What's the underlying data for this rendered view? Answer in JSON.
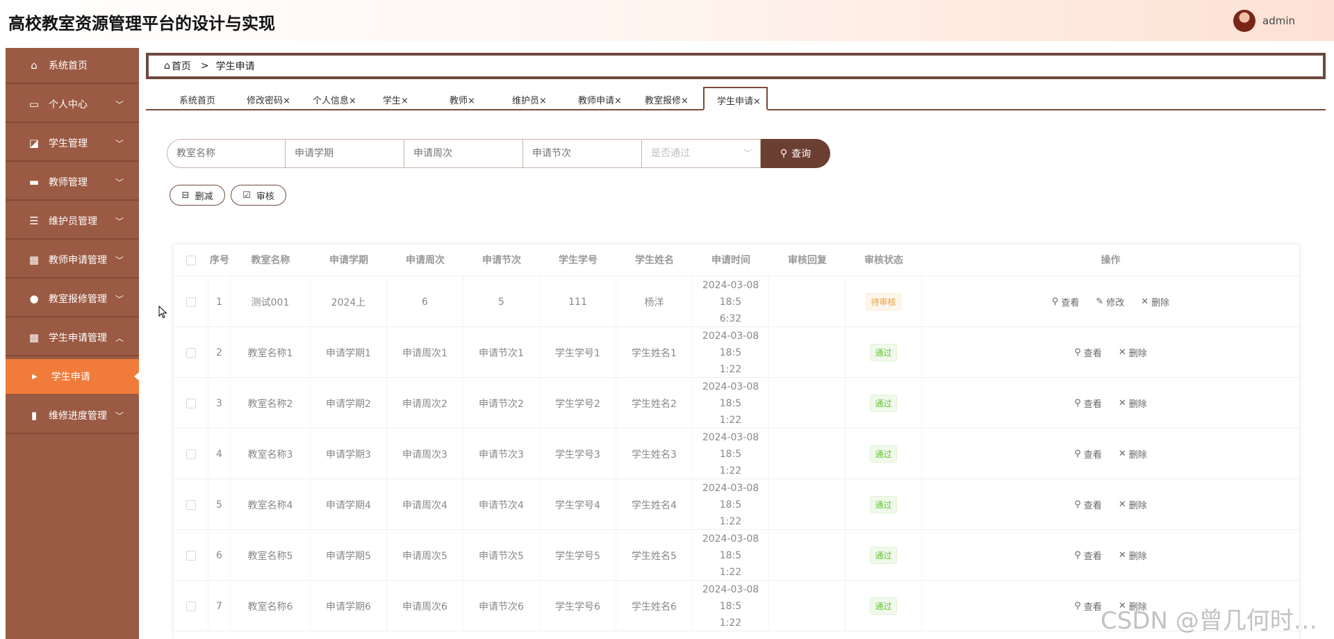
{
  "app": {
    "title": "高校教室资源管理平台的设计与实现",
    "username": "admin"
  },
  "sidebar": {
    "items": [
      {
        "label": "系统首页",
        "icon": "home-icon",
        "has_arrow": false
      },
      {
        "label": "个人中心",
        "icon": "id-card-icon",
        "has_arrow": true
      },
      {
        "label": "学生管理",
        "icon": "chart-icon",
        "has_arrow": true
      },
      {
        "label": "教师管理",
        "icon": "printer-icon",
        "has_arrow": true
      },
      {
        "label": "维护员管理",
        "icon": "list-icon",
        "has_arrow": true
      },
      {
        "label": "教师申请管理",
        "icon": "grid-icon",
        "has_arrow": true
      },
      {
        "label": "教室报修管理",
        "icon": "user-icon",
        "has_arrow": true
      },
      {
        "label": "学生申请管理",
        "icon": "grid-icon",
        "has_arrow": true,
        "expanded": true
      },
      {
        "label": "维修进度管理",
        "icon": "bar-chart-icon",
        "has_arrow": true
      }
    ],
    "sub_item": {
      "label": "学生申请"
    }
  },
  "breadcrumb": {
    "home": "首页",
    "separator": ">",
    "current": "学生申请"
  },
  "tabs": [
    {
      "label": "系统首页",
      "closable": false
    },
    {
      "label": "修改密码",
      "closable": true
    },
    {
      "label": "个人信息",
      "closable": true
    },
    {
      "label": "学生",
      "closable": true
    },
    {
      "label": "教师",
      "closable": true
    },
    {
      "label": "维护员",
      "closable": true
    },
    {
      "label": "教师申请",
      "closable": true
    },
    {
      "label": "教室报修",
      "closable": true
    },
    {
      "label": "学生申请",
      "closable": true,
      "active": true
    }
  ],
  "search": {
    "fields": [
      {
        "placeholder": "教室名称"
      },
      {
        "placeholder": "申请学期"
      },
      {
        "placeholder": "申请周次"
      },
      {
        "placeholder": "申请节次"
      }
    ],
    "select_placeholder": "是否通过",
    "button_label": "查询"
  },
  "actions": {
    "delete_label": "删减",
    "review_label": "审核"
  },
  "table": {
    "headers": [
      "序号",
      "教室名称",
      "申请学期",
      "申请周次",
      "申请节次",
      "学生学号",
      "学生姓名",
      "申请时间",
      "审核回复",
      "审核状态",
      "操作"
    ],
    "ops": {
      "view": "查看",
      "edit": "修改",
      "delete": "删除"
    },
    "rows": [
      {
        "no": "1",
        "room": "测试001",
        "term": "2024上",
        "week": "6",
        "period": "5",
        "sid": "111",
        "sname": "杨洋",
        "time1": "2024-03-08 18:5",
        "time2": "6:32",
        "reply": "",
        "status": "待审核",
        "status_type": "pending",
        "editable": true
      },
      {
        "no": "2",
        "room": "教室名称1",
        "term": "申请学期1",
        "week": "申请周次1",
        "period": "申请节次1",
        "sid": "学生学号1",
        "sname": "学生姓名1",
        "time1": "2024-03-08 18:5",
        "time2": "1:22",
        "reply": "",
        "status": "通过",
        "status_type": "pass",
        "editable": false
      },
      {
        "no": "3",
        "room": "教室名称2",
        "term": "申请学期2",
        "week": "申请周次2",
        "period": "申请节次2",
        "sid": "学生学号2",
        "sname": "学生姓名2",
        "time1": "2024-03-08 18:5",
        "time2": "1:22",
        "reply": "",
        "status": "通过",
        "status_type": "pass",
        "editable": false
      },
      {
        "no": "4",
        "room": "教室名称3",
        "term": "申请学期3",
        "week": "申请周次3",
        "period": "申请节次3",
        "sid": "学生学号3",
        "sname": "学生姓名3",
        "time1": "2024-03-08 18:5",
        "time2": "1:22",
        "reply": "",
        "status": "通过",
        "status_type": "pass",
        "editable": false
      },
      {
        "no": "5",
        "room": "教室名称4",
        "term": "申请学期4",
        "week": "申请周次4",
        "period": "申请节次4",
        "sid": "学生学号4",
        "sname": "学生姓名4",
        "time1": "2024-03-08 18:5",
        "time2": "1:22",
        "reply": "",
        "status": "通过",
        "status_type": "pass",
        "editable": false
      },
      {
        "no": "6",
        "room": "教室名称5",
        "term": "申请学期5",
        "week": "申请周次5",
        "period": "申请节次5",
        "sid": "学生学号5",
        "sname": "学生姓名5",
        "time1": "2024-03-08 18:5",
        "time2": "1:22",
        "reply": "",
        "status": "通过",
        "status_type": "pass",
        "editable": false
      },
      {
        "no": "7",
        "room": "教室名称6",
        "term": "申请学期6",
        "week": "申请周次6",
        "period": "申请节次6",
        "sid": "学生学号6",
        "sname": "学生姓名6",
        "time1": "2024-03-08 18:5",
        "time2": "1:22",
        "reply": "",
        "status": "通过",
        "status_type": "pass",
        "editable": false
      }
    ]
  },
  "watermark": "CSDN @曾几何时…",
  "colors": {
    "sidebar": "#9b5a43",
    "sidebar_active": "#f07b3a",
    "primary_button": "#6b3f32",
    "border": "#6e4a3e"
  }
}
